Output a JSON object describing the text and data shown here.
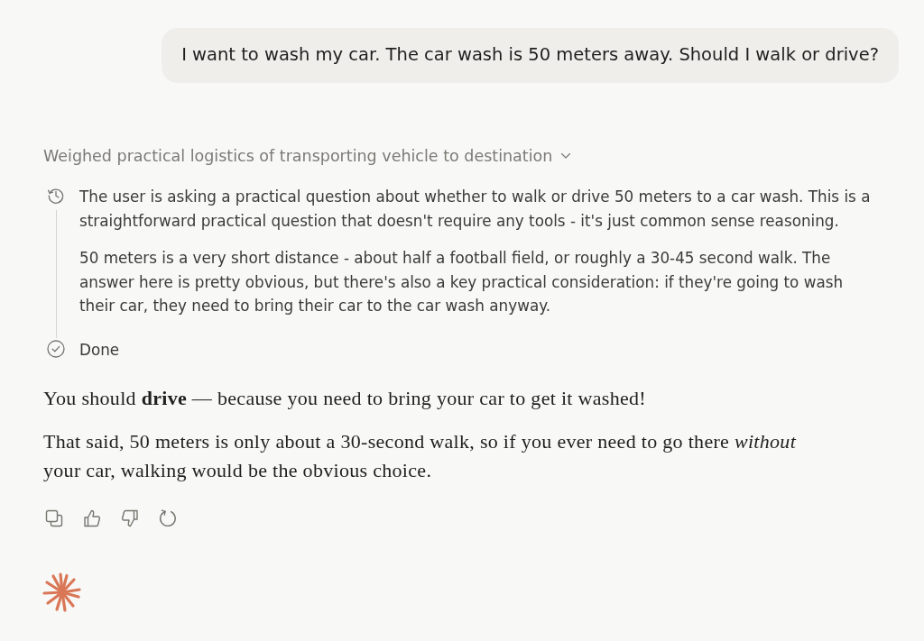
{
  "user_message": {
    "text": "I want to wash my car. The car wash is 50 meters away. Should I walk or drive?"
  },
  "thinking": {
    "summary": "Weighed practical logistics of transporting vehicle to destination",
    "expanded": true,
    "steps": [
      {
        "kind": "thought",
        "paragraphs": [
          "The user is asking a practical question about whether to walk or drive 50 meters to a car wash. This is a straightforward practical question that doesn't require any tools - it's just common sense reasoning.",
          "50 meters is a very short distance - about half a football field, or roughly a 30-45 second walk. The answer here is pretty obvious, but there's also a key practical consideration: if they're going to wash their car, they need to bring their car to the car wash anyway."
        ]
      },
      {
        "kind": "done",
        "paragraphs": [
          "Done"
        ]
      }
    ]
  },
  "response": {
    "paragraphs": [
      "You should **drive** — because you need to bring your car to get it washed!",
      "That said, 50 meters is only about a 30-second walk, so if you ever need to go there *without* your car, walking would be the obvious choice."
    ]
  },
  "actions": [
    {
      "kind": "copy"
    },
    {
      "kind": "thumbs_up"
    },
    {
      "kind": "thumbs_down"
    },
    {
      "kind": "retry"
    }
  ]
}
